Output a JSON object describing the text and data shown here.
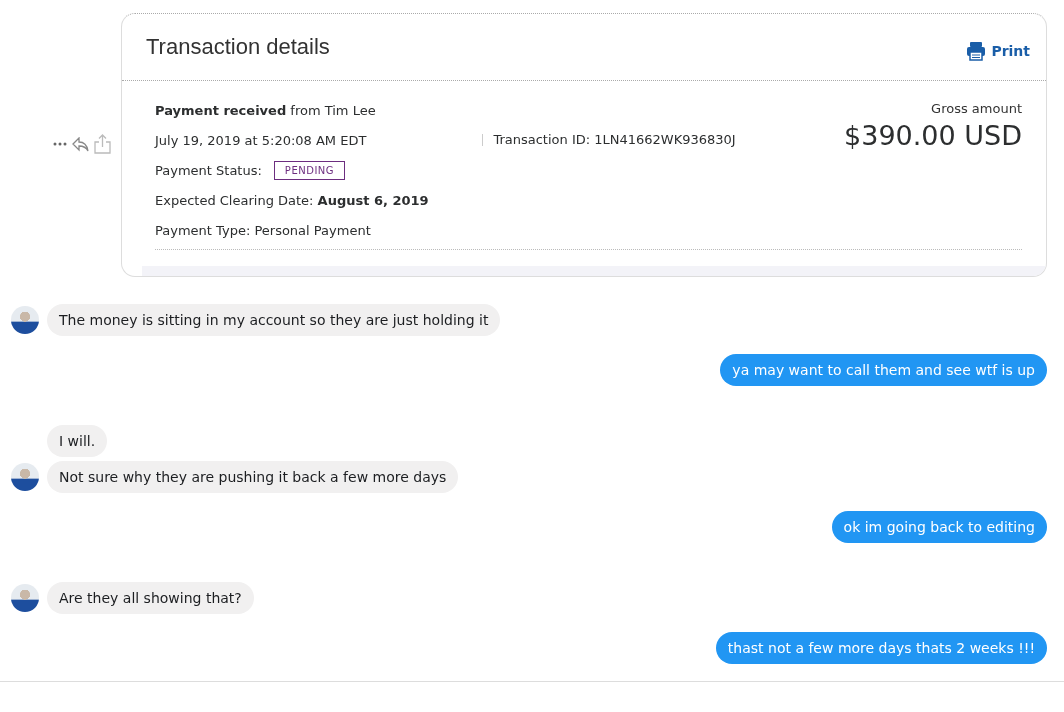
{
  "transaction": {
    "title": "Transaction details",
    "print_label": "Print",
    "heading": "**Payment received** from Tim Lee",
    "date": "July 19, 2019 at 5:20:08 AM EDT",
    "transaction_id": "Transaction ID: 1LN41662WK936830J",
    "status_label": "Payment Status:",
    "status": "PENDING",
    "clearing": "Expected Clearing Date: **August 6, 2019**",
    "payment_type": "Payment Type: Personal Payment",
    "gross_label": "Gross amount",
    "gross_amount": "$390.00 USD"
  },
  "messages": [
    {
      "kind": "received",
      "avatar": true,
      "text": "The money is sitting in my account so they are just holding it"
    },
    {
      "kind": "sent",
      "text": "ya may want to call them and see wtf is up"
    },
    {
      "kind": "received",
      "avatar": false,
      "text": "I will."
    },
    {
      "kind": "received",
      "avatar": true,
      "text": "Not sure why they are pushing it back a few more days"
    },
    {
      "kind": "sent",
      "text": "ok im going back to editing"
    },
    {
      "kind": "received",
      "avatar": true,
      "text": "Are they all showing that?"
    },
    {
      "kind": "sent",
      "text": "thast not a few more days thats 2 weeks !!!"
    }
  ]
}
